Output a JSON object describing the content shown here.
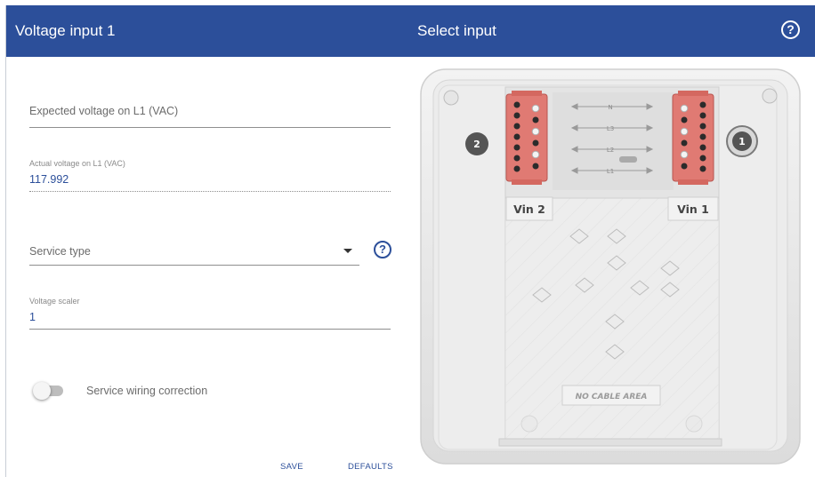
{
  "colors": {
    "header": "#2c4f9a",
    "accent": "#2c4f9a",
    "terminal": "#e07a73"
  },
  "left_panel": {
    "title": "Voltage input 1",
    "expected_voltage": {
      "placeholder": "Expected voltage on L1 (VAC)"
    },
    "actual_voltage": {
      "label": "Actual voltage on L1 (VAC)",
      "value": "117.992"
    },
    "service_type": {
      "placeholder": "Service type",
      "help_icon": "help-circle-icon"
    },
    "voltage_scaler": {
      "label": "Voltage scaler",
      "value": "1"
    },
    "wiring_correction": {
      "label": "Service wiring correction",
      "enabled": false
    },
    "buttons": {
      "save": "SAVE",
      "defaults": "DEFAULTS"
    }
  },
  "right_panel": {
    "title": "Select input",
    "help_icon": "help-circle-icon",
    "diagram": {
      "vin2_label": "Vin 2",
      "vin1_label": "Vin 1",
      "badge_2": "2",
      "badge_1": "1",
      "line_labels": [
        "N",
        "L3",
        "L2",
        "L1"
      ],
      "no_cable_area": "NO CABLE AREA"
    }
  }
}
